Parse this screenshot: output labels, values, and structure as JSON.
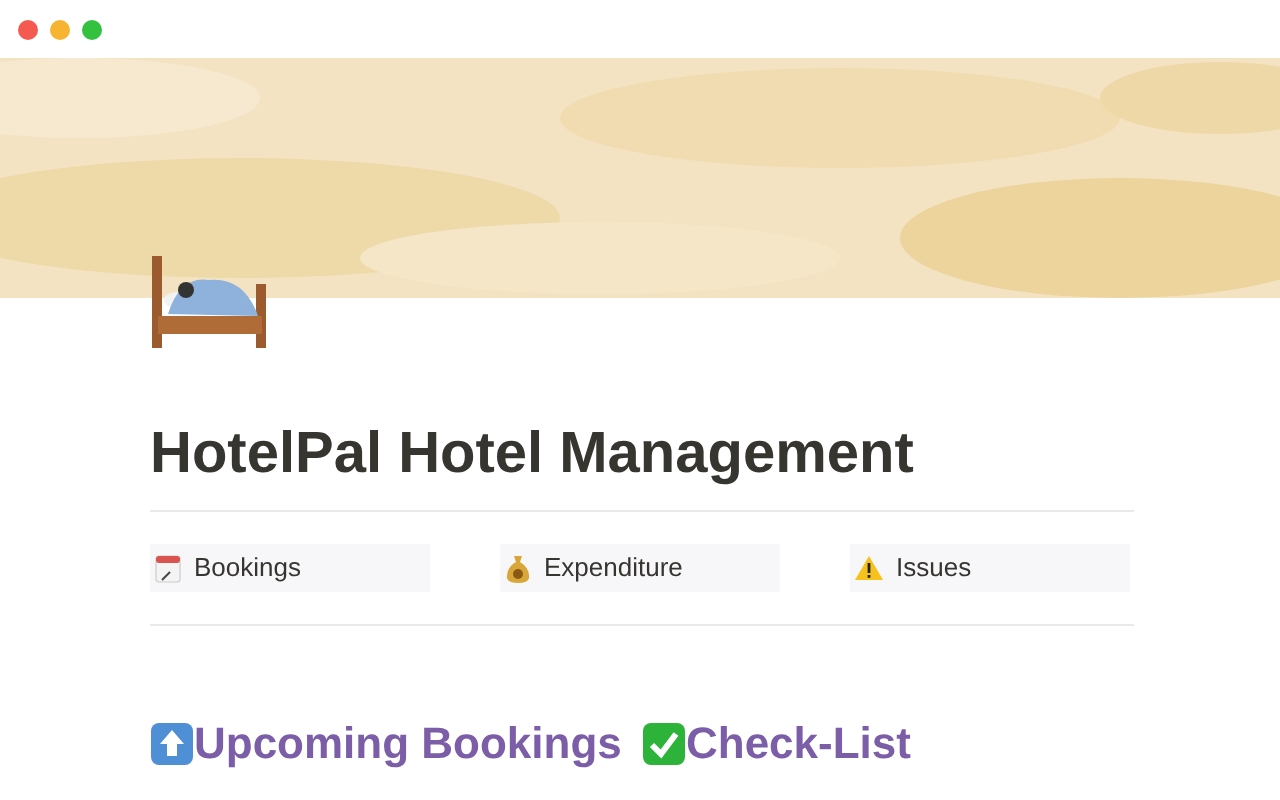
{
  "page": {
    "title": "HotelPal Hotel Management"
  },
  "links": [
    {
      "kind": "calendar",
      "label": "Bookings"
    },
    {
      "kind": "money",
      "label": "Expenditure"
    },
    {
      "kind": "warning",
      "label": "Issues"
    }
  ],
  "sections": [
    {
      "kind": "up",
      "heading": "Upcoming Bookings"
    },
    {
      "kind": "check",
      "heading": "Check-List"
    }
  ]
}
